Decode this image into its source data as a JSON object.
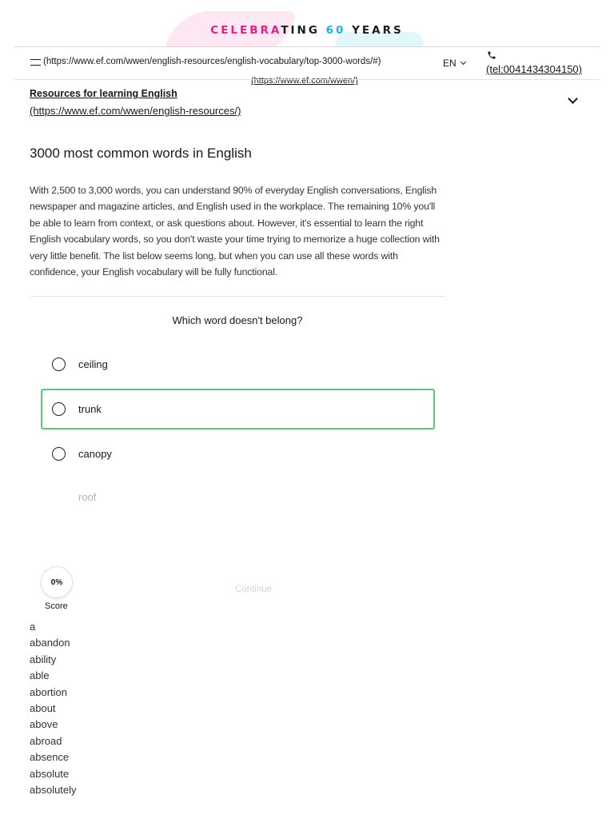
{
  "banner": {
    "part1": "CELEBRA",
    "part2": "TING ",
    "part3": "60",
    "part4": " YEARS"
  },
  "nav": {
    "menu_link": "(https://www.ef.com/wwen/english-resources/english-vocabulary/top-3000-words/#)",
    "home_link": "(https://www.ef.com/wwen/)",
    "language": "EN",
    "phone_link": "(tel:0041434304150)"
  },
  "resources": {
    "title": "Resources for learning English",
    "url": "(https://www.ef.com/wwen/english-resources/)"
  },
  "article": {
    "title": "3000 most common words in English",
    "intro": "With 2,500 to 3,000 words, you can understand 90% of everyday English conversations, English newspaper and magazine articles, and English used in the workplace. The remaining 10% you'll be able to learn from context, or ask questions about. However, it's essential to learn the right English vocabulary words, so you don't waste your time trying to memorize a huge collection with very little benefit. The list below seems long, but when you can use all these words with confidence, your English vocabulary will be fully functional."
  },
  "quiz": {
    "question": "Which word doesn't belong?",
    "options": [
      {
        "label": "ceiling"
      },
      {
        "label": "trunk",
        "selected": true
      },
      {
        "label": "canopy"
      },
      {
        "label": "roof"
      }
    ],
    "score_value": "0%",
    "score_label": "Score",
    "continue_label": "Continue"
  },
  "words": [
    "a",
    "abandon",
    "ability",
    "able",
    "abortion",
    "about",
    "above",
    "abroad",
    "absence",
    "absolute",
    "absolutely"
  ],
  "colors": {
    "banner_pink": "#ec1b8c",
    "banner_blue": "#1ab2e8",
    "selected_border": "#5bc97a",
    "text": "#191919"
  }
}
